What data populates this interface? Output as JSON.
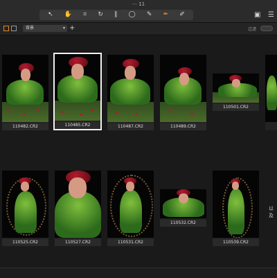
{
  "window": {
    "title": "⋯ 11"
  },
  "toolbar": {
    "tools": [
      "select-arrow-icon",
      "hand-pan-icon",
      "crop-icon",
      "rotate-icon",
      "straighten-icon",
      "ellipse-mask-icon",
      "brush-icon",
      "eyedropper-icon",
      "erase-icon"
    ]
  },
  "subbar": {
    "dropdown_value": "背景",
    "right_label": "过滤"
  },
  "thumbnails": [
    {
      "label": "110482.CR2"
    },
    {
      "label": "110485.CR2"
    },
    {
      "label": "110487.CR2"
    },
    {
      "label": "110489.CR2"
    },
    {
      "label": "110501.CR2"
    },
    {
      "label": "110525.CR2"
    },
    {
      "label": "110527.CR2"
    },
    {
      "label": "110531.CR2"
    },
    {
      "label": "110532.CR2"
    },
    {
      "label": "110539.CR2"
    }
  ],
  "side_text": "以及",
  "accent_color": "#e08a2a"
}
